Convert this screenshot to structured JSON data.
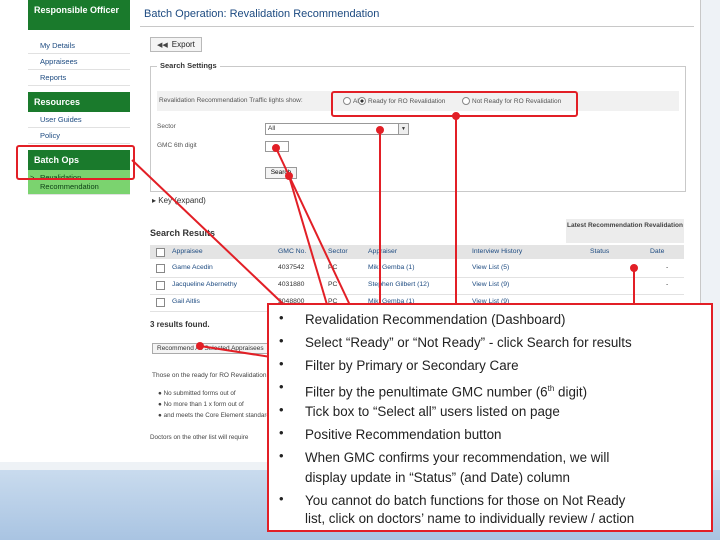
{
  "sidebar": {
    "responsible_officer": "Responsible Officer",
    "my_details": "My Details",
    "appraisees": "Appraisees",
    "reports": "Reports",
    "resources": "Resources",
    "user_guides": "User Guides",
    "policy": "Policy",
    "batch_ops": "Batch Ops",
    "revalidation_line1": "Revalidation",
    "revalidation_line2": "Recommendation",
    "active_marker": ">"
  },
  "header": {
    "title": "Batch Operation: Revalidation Recommendation"
  },
  "toolbar": {
    "export_label": "Export"
  },
  "search_settings": {
    "legend": "Search Settings",
    "filter_label": "Revalidation Recommendation Traffic lights show:",
    "option_all": "All",
    "option_ready": "Ready for RO Revalidation",
    "option_not_ready": "Not Ready for RO Revalidation",
    "sector_label": "Sector",
    "sector_value": "All",
    "gmc_digit_label": "GMC 6th digit",
    "search_button": "Search"
  },
  "key": {
    "label": "Key (expand)"
  },
  "results": {
    "title": "Search Results",
    "latest_header": "Latest Recommendation Revalidation",
    "columns": [
      "Appraisee",
      "GMC No.",
      "Sector",
      "Appraiser",
      "Interview History",
      "Status",
      "Date"
    ],
    "rows": [
      {
        "appraisee": "Game Acedin",
        "gmc": "4037542",
        "sector": "PC",
        "appraiser": "Miki Gemba (1)",
        "history": "View List (5)",
        "status": "",
        "date": "-"
      },
      {
        "appraisee": "Jacqueline Abernethy",
        "gmc": "4031880",
        "sector": "PC",
        "appraiser": "Stephen Gilbert (12)",
        "history": "View List (9)",
        "status": "",
        "date": "-"
      },
      {
        "appraisee": "Gail Aitlis",
        "gmc": "3048800",
        "sector": "PC",
        "appraiser": "Miki Gemba (1)",
        "history": "View List (9)",
        "status": "",
        "date": ""
      }
    ],
    "found_text": "3 results found.",
    "positive_button": "Recommend All Selected Appraisees",
    "ready_note": "Those on the ready for RO Revalidation list:",
    "bullets": [
      "No submitted forms out of",
      "No more than 1 x form out of",
      "and meets the Core Element standard"
    ],
    "others_note": "Doctors on the other list will require"
  },
  "callout": {
    "items": [
      "Revalidation Recommendation (Dashboard)",
      "Select “Ready” or “Not Ready” - click Search for results",
      "Filter by Primary or Secondary Care",
      "Filter by the penultimate GMC number (6",
      "Tick box to “Select all” users listed on page",
      "Positive Recommendation button",
      "When GMC confirms your recommendation, we will",
      "You cannot do batch functions for those on Not Ready"
    ],
    "item4_sup": "th",
    "item4_tail": " digit)",
    "item7_cont": "display update in “Status” (and Date) column",
    "item8_cont": "list, click on doctors’ name to individually review / action"
  },
  "colors": {
    "brand_green": "#1a7a2c",
    "highlight_green": "#7bd36f",
    "annotation_red": "#e21f26",
    "link_blue": "#1c4a80"
  }
}
